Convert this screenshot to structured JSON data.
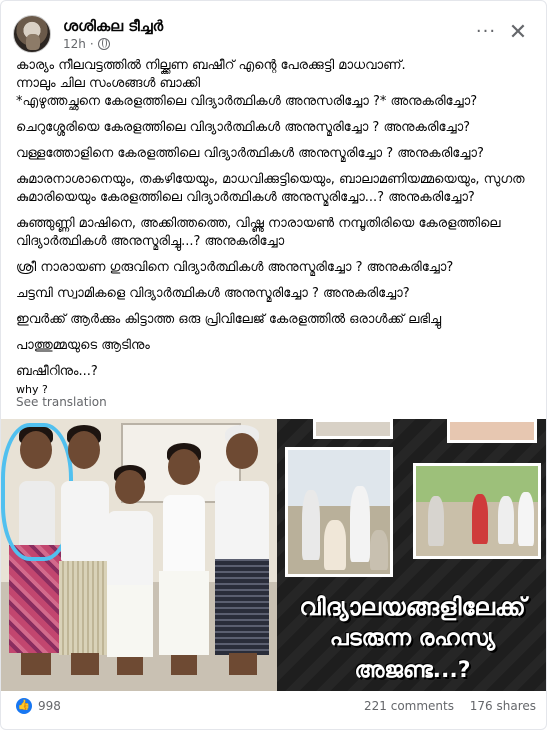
{
  "post": {
    "author": "ശശികല ടീച്ചർ",
    "time": "12h",
    "more_label": "···",
    "close_label": "✕"
  },
  "text": {
    "p1": "കാര്യം നീലവട്ടത്തിൽ നില്ക്കണ ബഷീറ് എന്റെ പേരക്കുട്ടി മാധവാണ്.",
    "p2": "ന്നാലും ചില സംശങ്ങൾ ബാക്കി",
    "p3": "*എഴുത്തച്ഛനെ കേരളത്തിലെ വിദ്യാർത്ഥികൾ അനുസരിച്ചോ ?* അനുകരിച്ചോ?",
    "p4": "ചെറുശ്ശേരിയെ കേരളത്തിലെ വിദ്യാർത്ഥികൾ അനുസ്മരിച്ചോ ? അനുകരിച്ചോ?",
    "p5": "വള്ളത്തോളിനെ കേരളത്തിലെ വിദ്യാർത്ഥികൾ അനുസ്മരിച്ചോ ? അനുകരിച്ചോ?",
    "p6": "കുമാരനാശാനെയും, തകഴിയേയും, മാധവിക്കുട്ടിയെയും, ബാലാമണിയമ്മയെയും, സുഗത കുമാരിയെയും കേരളത്തിലെ വിദ്യാർത്ഥികൾ അനുസ്മരിച്ചോ...? അനുകരിച്ചോ?",
    "p7": "കുഞ്ഞുണ്ണി മാഷിനെ, അക്കിത്തത്തെ, വിഷ്ണു നാരായൺ നമ്പൂതിരിയെ കേരളത്തിലെ വിദ്യാർത്ഥികൾ അനുസ്മരിച്ചു...? അനുകരിച്ചോ",
    "p8": "ശ്രീ നാരായണ ഗുരുവിനെ വിദ്യാർത്ഥികൾ അനുസ്മരിച്ചോ ? അനുകരിച്ചോ?",
    "p9": "ചട്ടമ്പി സ്വാമികളെ വിദ്യാർത്ഥികൾ അനുസ്മരിച്ചോ ? അനുകരിച്ചോ?",
    "p10": "ഇവർക്ക് ആർക്കും കിട്ടാത്ത ഒരു പ്രിവിലേജ് കേരളത്തിൽ ഒരാൾക്ക് ലഭിച്ചു",
    "p11": "പാത്തുമ്മയുടെ ആടിനും",
    "p12": "ബഷീറിനും...?",
    "p13": "why ?"
  },
  "see_translation": "See translation",
  "media": {
    "headline_line1": "വിദ്യാലയങ്ങളിലേക്ക്",
    "headline_line2": "പടരുന്ന രഹസ്യ",
    "headline_line3": "അജണ്ട...?",
    "highlight_color": "#51c0ef"
  },
  "footer": {
    "reactions_count": "998",
    "comments": "221 comments",
    "shares": "176 shares",
    "like_icon": "thumbs-up-icon"
  },
  "colors": {
    "text": "#050505",
    "muted": "#65676b",
    "like_blue": "#1877f2"
  }
}
